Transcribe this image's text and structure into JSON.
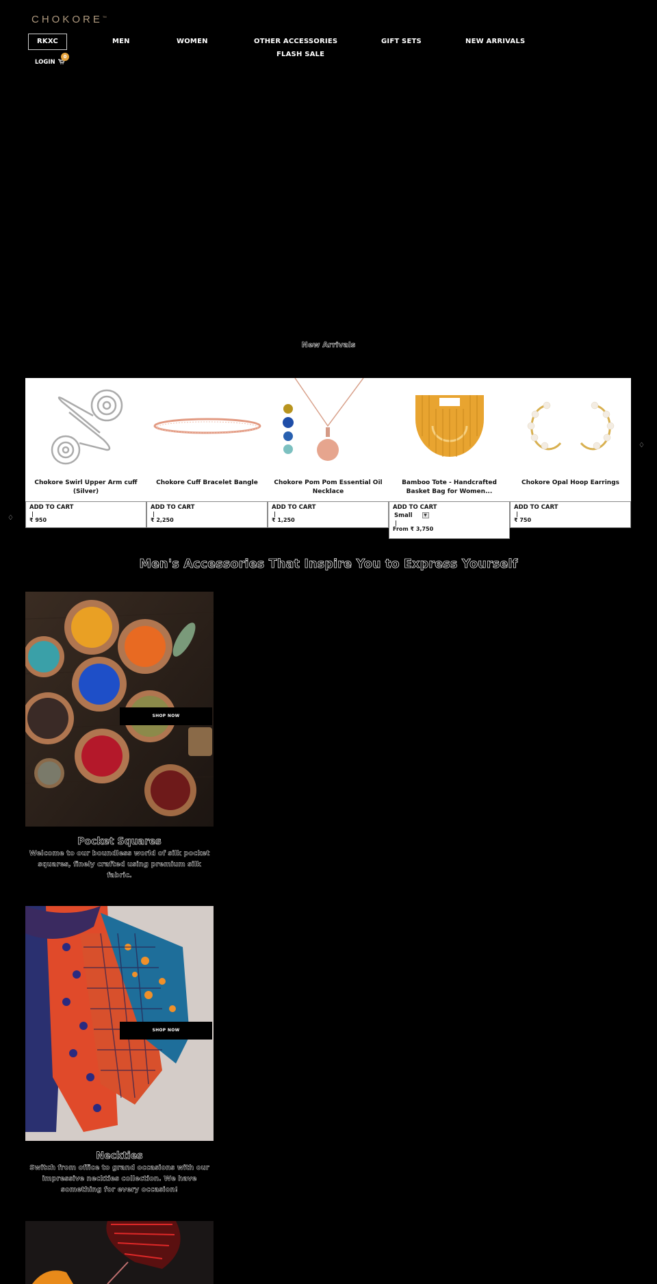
{
  "header": {
    "logo": "CHOKORE",
    "logo_tm": "TM",
    "nav": [
      {
        "label": "RKXC"
      },
      {
        "label": "MEN"
      },
      {
        "label": "WOMEN"
      },
      {
        "label": "OTHER ACCESSORIES"
      },
      {
        "label": "GIFT SETS"
      },
      {
        "label": "NEW ARRIVALS"
      },
      {
        "label": "FLASH SALE"
      }
    ],
    "login_label": "LOGIN",
    "cart_icon": "cart-icon",
    "cart_count": "0"
  },
  "new_arrivals": {
    "title": "New Arrivals",
    "prev_icon": "arrow-left-icon",
    "next_icon": "arrow-right-icon",
    "products": [
      {
        "name": "Chokore Swirl Upper Arm cuff (Silver)",
        "add_label": "ADD TO CART",
        "separator": "|",
        "price": "₹ 950"
      },
      {
        "name": "Chokore Cuff Bracelet Bangle",
        "add_label": "ADD TO CART",
        "separator": "|",
        "price": "₹ 2,250"
      },
      {
        "name": "Chokore Pom Pom Essential Oil Necklace",
        "add_label": "ADD TO CART",
        "separator": "|",
        "price": "₹ 1,250"
      },
      {
        "name": "Bamboo Tote - Handcrafted Basket Bag for Women...",
        "add_label": "ADD TO CART",
        "variant": "Small",
        "separator": "|",
        "price": "From ₹ 3,750"
      },
      {
        "name": "Chokore Opal Hoop Earrings",
        "add_label": "ADD TO CART",
        "separator": "|",
        "price": "₹ 750"
      }
    ]
  },
  "mens_section": {
    "heading": "Men's Accessories That Inspire You to Express Yourself",
    "categories": [
      {
        "title": "Pocket Squares",
        "description": "Welcome to our boundless world of silk pocket squares, finely crafted using premium silk fabric.",
        "button": "SHOP NOW"
      },
      {
        "title": "Neckties",
        "description": "Switch from office to grand occasions with our impressive neckties collection. We have something for every occasion!",
        "button": "SHOP NOW"
      }
    ]
  }
}
